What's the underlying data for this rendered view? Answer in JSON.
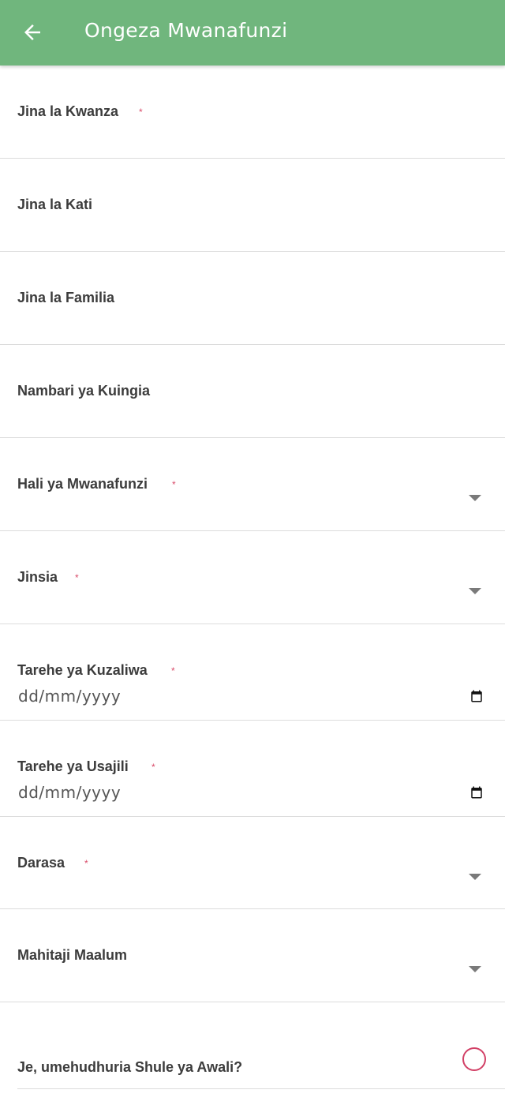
{
  "header": {
    "title": "Ongeza Mwanafunzi"
  },
  "required_marker": "*",
  "fields": {
    "first_name": {
      "label": "Jina la Kwanza"
    },
    "middle_name": {
      "label": "Jina la Kati"
    },
    "last_name": {
      "label": "Jina la Familia"
    },
    "admission_number": {
      "label": "Nambari ya Kuingia"
    },
    "student_status": {
      "label": "Hali ya Mwanafunzi"
    },
    "gender": {
      "label": "Jinsia"
    },
    "birth_date": {
      "label": "Tarehe ya Kuzaliwa",
      "value": "dd/mm/yyyy"
    },
    "registration_date": {
      "label": "Tarehe ya Usajili",
      "value": "dd/mm/yyyy"
    },
    "class": {
      "label": "Darasa"
    },
    "special_needs": {
      "label": "Mahitaji Maalum"
    },
    "preschool": {
      "label": "Je, umehudhuria Shule ya Awali?"
    }
  },
  "colors": {
    "app_bar": "#70b67d",
    "required": "#d94c6a",
    "radio": "#d24066"
  },
  "icons": {
    "back": "arrow-left-icon",
    "dropdown": "chevron-down-icon",
    "date": "calendar-icon"
  }
}
